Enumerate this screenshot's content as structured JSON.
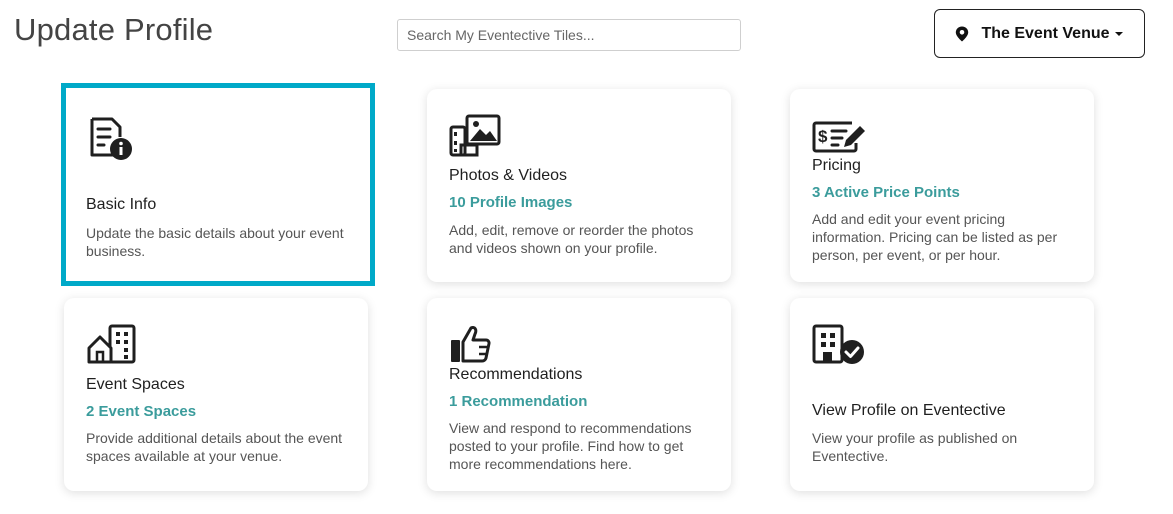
{
  "header": {
    "title": "Update Profile",
    "search_placeholder": "Search My Eventective Tiles...",
    "search_value": "",
    "venue_label": "The Event Venue"
  },
  "colors": {
    "accent": "#00a9c8",
    "link": "#3b9c9c"
  },
  "tiles": [
    {
      "title": "Basic Info",
      "subtitle": "",
      "description": "Update the basic details about your event business.",
      "icon": "document-info-icon",
      "selected": true
    },
    {
      "title": "Photos & Videos",
      "subtitle": "10 Profile Images",
      "description": "Add, edit, remove or reorder the photos and videos shown on your profile.",
      "icon": "photos-videos-icon",
      "selected": false
    },
    {
      "title": "Pricing",
      "subtitle": "3 Active Price Points",
      "description": "Add and edit your event pricing information. Pricing can be listed as per person, per event, or per hour.",
      "icon": "pricing-icon",
      "selected": false
    },
    {
      "title": "Event Spaces",
      "subtitle": "2 Event Spaces",
      "description": "Provide additional details about the event spaces available at your venue.",
      "icon": "event-spaces-icon",
      "selected": false
    },
    {
      "title": "Recommendations",
      "subtitle": "1 Recommendation",
      "description": "View and respond to recommendations posted to your profile. Find how to get more recommendations here.",
      "icon": "thumbs-up-icon",
      "selected": false
    },
    {
      "title": "View Profile on Eventective",
      "subtitle": "",
      "description": "View your profile as published on Eventective.",
      "icon": "building-check-icon",
      "selected": false
    }
  ]
}
